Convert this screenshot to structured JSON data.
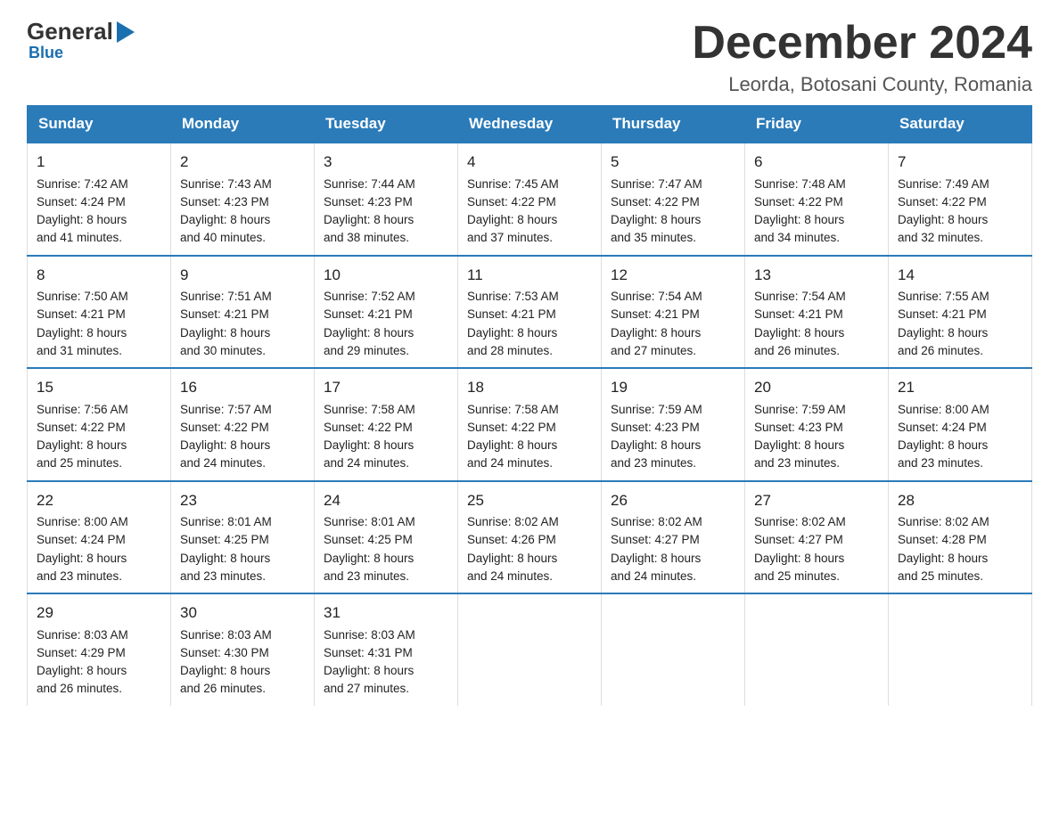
{
  "header": {
    "logo": {
      "general": "General",
      "blue": "Blue"
    },
    "title": "December 2024",
    "subtitle": "Leorda, Botosani County, Romania"
  },
  "calendar": {
    "days_of_week": [
      "Sunday",
      "Monday",
      "Tuesday",
      "Wednesday",
      "Thursday",
      "Friday",
      "Saturday"
    ],
    "weeks": [
      [
        {
          "day": "1",
          "sunrise": "Sunrise: 7:42 AM",
          "sunset": "Sunset: 4:24 PM",
          "daylight": "Daylight: 8 hours",
          "daylight2": "and 41 minutes."
        },
        {
          "day": "2",
          "sunrise": "Sunrise: 7:43 AM",
          "sunset": "Sunset: 4:23 PM",
          "daylight": "Daylight: 8 hours",
          "daylight2": "and 40 minutes."
        },
        {
          "day": "3",
          "sunrise": "Sunrise: 7:44 AM",
          "sunset": "Sunset: 4:23 PM",
          "daylight": "Daylight: 8 hours",
          "daylight2": "and 38 minutes."
        },
        {
          "day": "4",
          "sunrise": "Sunrise: 7:45 AM",
          "sunset": "Sunset: 4:22 PM",
          "daylight": "Daylight: 8 hours",
          "daylight2": "and 37 minutes."
        },
        {
          "day": "5",
          "sunrise": "Sunrise: 7:47 AM",
          "sunset": "Sunset: 4:22 PM",
          "daylight": "Daylight: 8 hours",
          "daylight2": "and 35 minutes."
        },
        {
          "day": "6",
          "sunrise": "Sunrise: 7:48 AM",
          "sunset": "Sunset: 4:22 PM",
          "daylight": "Daylight: 8 hours",
          "daylight2": "and 34 minutes."
        },
        {
          "day": "7",
          "sunrise": "Sunrise: 7:49 AM",
          "sunset": "Sunset: 4:22 PM",
          "daylight": "Daylight: 8 hours",
          "daylight2": "and 32 minutes."
        }
      ],
      [
        {
          "day": "8",
          "sunrise": "Sunrise: 7:50 AM",
          "sunset": "Sunset: 4:21 PM",
          "daylight": "Daylight: 8 hours",
          "daylight2": "and 31 minutes."
        },
        {
          "day": "9",
          "sunrise": "Sunrise: 7:51 AM",
          "sunset": "Sunset: 4:21 PM",
          "daylight": "Daylight: 8 hours",
          "daylight2": "and 30 minutes."
        },
        {
          "day": "10",
          "sunrise": "Sunrise: 7:52 AM",
          "sunset": "Sunset: 4:21 PM",
          "daylight": "Daylight: 8 hours",
          "daylight2": "and 29 minutes."
        },
        {
          "day": "11",
          "sunrise": "Sunrise: 7:53 AM",
          "sunset": "Sunset: 4:21 PM",
          "daylight": "Daylight: 8 hours",
          "daylight2": "and 28 minutes."
        },
        {
          "day": "12",
          "sunrise": "Sunrise: 7:54 AM",
          "sunset": "Sunset: 4:21 PM",
          "daylight": "Daylight: 8 hours",
          "daylight2": "and 27 minutes."
        },
        {
          "day": "13",
          "sunrise": "Sunrise: 7:54 AM",
          "sunset": "Sunset: 4:21 PM",
          "daylight": "Daylight: 8 hours",
          "daylight2": "and 26 minutes."
        },
        {
          "day": "14",
          "sunrise": "Sunrise: 7:55 AM",
          "sunset": "Sunset: 4:21 PM",
          "daylight": "Daylight: 8 hours",
          "daylight2": "and 26 minutes."
        }
      ],
      [
        {
          "day": "15",
          "sunrise": "Sunrise: 7:56 AM",
          "sunset": "Sunset: 4:22 PM",
          "daylight": "Daylight: 8 hours",
          "daylight2": "and 25 minutes."
        },
        {
          "day": "16",
          "sunrise": "Sunrise: 7:57 AM",
          "sunset": "Sunset: 4:22 PM",
          "daylight": "Daylight: 8 hours",
          "daylight2": "and 24 minutes."
        },
        {
          "day": "17",
          "sunrise": "Sunrise: 7:58 AM",
          "sunset": "Sunset: 4:22 PM",
          "daylight": "Daylight: 8 hours",
          "daylight2": "and 24 minutes."
        },
        {
          "day": "18",
          "sunrise": "Sunrise: 7:58 AM",
          "sunset": "Sunset: 4:22 PM",
          "daylight": "Daylight: 8 hours",
          "daylight2": "and 24 minutes."
        },
        {
          "day": "19",
          "sunrise": "Sunrise: 7:59 AM",
          "sunset": "Sunset: 4:23 PM",
          "daylight": "Daylight: 8 hours",
          "daylight2": "and 23 minutes."
        },
        {
          "day": "20",
          "sunrise": "Sunrise: 7:59 AM",
          "sunset": "Sunset: 4:23 PM",
          "daylight": "Daylight: 8 hours",
          "daylight2": "and 23 minutes."
        },
        {
          "day": "21",
          "sunrise": "Sunrise: 8:00 AM",
          "sunset": "Sunset: 4:24 PM",
          "daylight": "Daylight: 8 hours",
          "daylight2": "and 23 minutes."
        }
      ],
      [
        {
          "day": "22",
          "sunrise": "Sunrise: 8:00 AM",
          "sunset": "Sunset: 4:24 PM",
          "daylight": "Daylight: 8 hours",
          "daylight2": "and 23 minutes."
        },
        {
          "day": "23",
          "sunrise": "Sunrise: 8:01 AM",
          "sunset": "Sunset: 4:25 PM",
          "daylight": "Daylight: 8 hours",
          "daylight2": "and 23 minutes."
        },
        {
          "day": "24",
          "sunrise": "Sunrise: 8:01 AM",
          "sunset": "Sunset: 4:25 PM",
          "daylight": "Daylight: 8 hours",
          "daylight2": "and 23 minutes."
        },
        {
          "day": "25",
          "sunrise": "Sunrise: 8:02 AM",
          "sunset": "Sunset: 4:26 PM",
          "daylight": "Daylight: 8 hours",
          "daylight2": "and 24 minutes."
        },
        {
          "day": "26",
          "sunrise": "Sunrise: 8:02 AM",
          "sunset": "Sunset: 4:27 PM",
          "daylight": "Daylight: 8 hours",
          "daylight2": "and 24 minutes."
        },
        {
          "day": "27",
          "sunrise": "Sunrise: 8:02 AM",
          "sunset": "Sunset: 4:27 PM",
          "daylight": "Daylight: 8 hours",
          "daylight2": "and 25 minutes."
        },
        {
          "day": "28",
          "sunrise": "Sunrise: 8:02 AM",
          "sunset": "Sunset: 4:28 PM",
          "daylight": "Daylight: 8 hours",
          "daylight2": "and 25 minutes."
        }
      ],
      [
        {
          "day": "29",
          "sunrise": "Sunrise: 8:03 AM",
          "sunset": "Sunset: 4:29 PM",
          "daylight": "Daylight: 8 hours",
          "daylight2": "and 26 minutes."
        },
        {
          "day": "30",
          "sunrise": "Sunrise: 8:03 AM",
          "sunset": "Sunset: 4:30 PM",
          "daylight": "Daylight: 8 hours",
          "daylight2": "and 26 minutes."
        },
        {
          "day": "31",
          "sunrise": "Sunrise: 8:03 AM",
          "sunset": "Sunset: 4:31 PM",
          "daylight": "Daylight: 8 hours",
          "daylight2": "and 27 minutes."
        },
        null,
        null,
        null,
        null
      ]
    ]
  }
}
